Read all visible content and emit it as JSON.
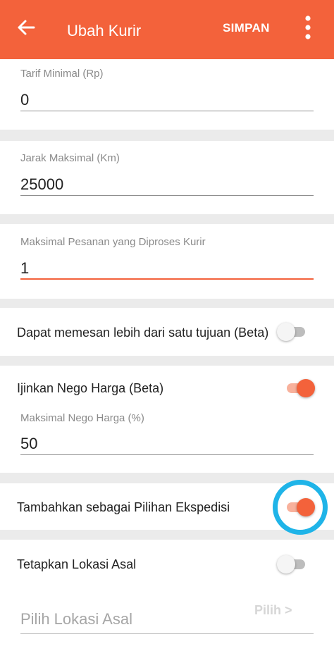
{
  "appbar": {
    "title": "Ubah Kurir",
    "save_label": "SIMPAN",
    "back_icon": "arrow-left-icon",
    "more_icon": "more-vertical-icon"
  },
  "fields": {
    "min_tariff": {
      "label": "Tarif Minimal (Rp)",
      "value": "0"
    },
    "max_distance": {
      "label": "Jarak Maksimal (Km)",
      "value": "25000"
    },
    "max_orders": {
      "label": "Maksimal Pesanan yang Diproses Kurir",
      "value": "1"
    },
    "max_nego": {
      "label": "Maksimal Nego Harga (%)",
      "value": "50"
    }
  },
  "toggles": {
    "multi_destination": {
      "label": "Dapat memesan lebih dari satu tujuan (Beta)",
      "checked": false
    },
    "nego_price": {
      "label": "Ijinkan Nego Harga (Beta)",
      "checked": true
    },
    "expedition_option": {
      "label": "Tambahkan sebagai Pilihan Ekspedisi",
      "checked": true
    },
    "origin_location": {
      "label": "Tetapkan Lokasi Asal",
      "checked": false
    }
  },
  "origin_picker": {
    "placeholder": "Pilih Lokasi Asal",
    "pick_label": "Pilih >"
  },
  "colors": {
    "accent": "#f3623b",
    "highlight_ring": "#1fb4e8",
    "background": "#ebebeb"
  }
}
